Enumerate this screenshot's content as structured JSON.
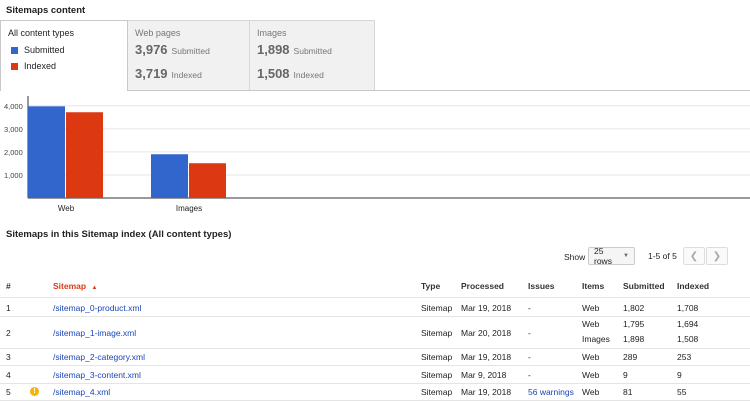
{
  "sitemaps_content": {
    "title": "Sitemaps content",
    "tabs": {
      "all": {
        "title": "All content types",
        "legend": [
          {
            "label": "Submitted",
            "color": "#3366cc"
          },
          {
            "label": "Indexed",
            "color": "#dc3912"
          }
        ]
      },
      "web": {
        "title": "Web pages",
        "submitted": "3,976",
        "submitted_label": "Submitted",
        "indexed": "3,719",
        "indexed_label": "Indexed"
      },
      "images": {
        "title": "Images",
        "submitted": "1,898",
        "submitted_label": "Submitted",
        "indexed": "1,508",
        "indexed_label": "Indexed"
      }
    }
  },
  "chart_data": {
    "type": "bar",
    "categories": [
      "Web",
      "Images"
    ],
    "series": [
      {
        "name": "Submitted",
        "color": "#3366cc",
        "values": [
          3976,
          1898
        ]
      },
      {
        "name": "Indexed",
        "color": "#dc3912",
        "values": [
          3719,
          1508
        ]
      }
    ],
    "yticks": [
      1000,
      2000,
      3000,
      4000
    ],
    "ytick_labels": [
      "1,000",
      "2,000",
      "3,000",
      "4,000"
    ],
    "ylim": [
      0,
      4250
    ],
    "grid": true,
    "title": "",
    "xlabel": "",
    "ylabel": ""
  },
  "index_section": {
    "title": "Sitemaps in this Sitemap index (All content types)",
    "show_label": "Show",
    "rows_value": "25 rows",
    "pagination": "1-5 of 5",
    "prev_icon": "chevron-left-icon",
    "next_icon": "chevron-right-icon"
  },
  "table": {
    "headers": {
      "num": "#",
      "sitemap": "Sitemap",
      "sort_indicator": "▲",
      "type": "Type",
      "processed": "Processed",
      "issues": "Issues",
      "items": "Items",
      "submitted": "Submitted",
      "indexed": "Indexed"
    },
    "rows": [
      {
        "num": "1",
        "sitemap": "/sitemap_0-product.xml",
        "type": "Sitemap",
        "processed": "Mar 19, 2018",
        "issues": "-",
        "lines": [
          {
            "item": "Web",
            "submitted": "1,802",
            "indexed": "1,708"
          }
        ]
      },
      {
        "num": "2",
        "sitemap": "/sitemap_1-image.xml",
        "type": "Sitemap",
        "processed": "Mar 20, 2018",
        "issues": "-",
        "lines": [
          {
            "item": "Web",
            "submitted": "1,795",
            "indexed": "1,694"
          },
          {
            "item": "Images",
            "submitted": "1,898",
            "indexed": "1,508"
          }
        ]
      },
      {
        "num": "3",
        "sitemap": "/sitemap_2-category.xml",
        "type": "Sitemap",
        "processed": "Mar 19, 2018",
        "issues": "-",
        "lines": [
          {
            "item": "Web",
            "submitted": "289",
            "indexed": "253"
          }
        ]
      },
      {
        "num": "4",
        "sitemap": "/sitemap_3-content.xml",
        "type": "Sitemap",
        "processed": "Mar 9, 2018",
        "issues": "-",
        "lines": [
          {
            "item": "Web",
            "submitted": "9",
            "indexed": "9"
          }
        ]
      },
      {
        "num": "5",
        "sitemap": "/sitemap_4.xml",
        "type": "Sitemap",
        "processed": "Mar 19, 2018",
        "issues": "56 warnings",
        "issues_link": true,
        "warning_icon": "warning-icon",
        "warning_glyph": "!",
        "lines": [
          {
            "item": "Web",
            "submitted": "81",
            "indexed": "55"
          }
        ]
      }
    ]
  }
}
